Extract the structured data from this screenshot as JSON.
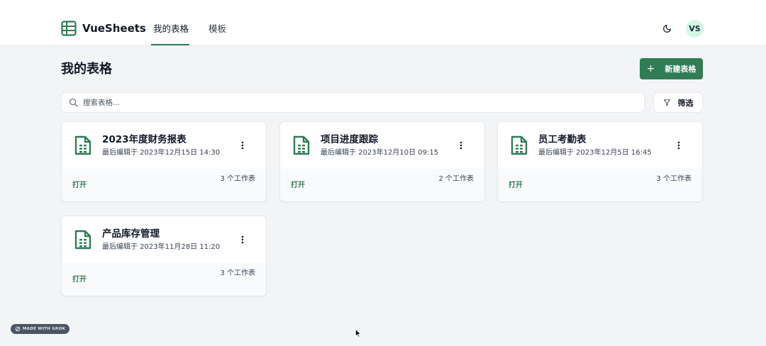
{
  "app": {
    "brand": "VueSheets",
    "accent_color": "#2e7d55"
  },
  "nav": {
    "tabs": [
      {
        "label": "我的表格",
        "active": true
      },
      {
        "label": "模板",
        "active": false
      }
    ]
  },
  "header": {
    "theme_icon": "moon-icon",
    "avatar_initials": "VS"
  },
  "page": {
    "title": "我的表格",
    "new_button_label": "新建表格"
  },
  "search": {
    "placeholder": "搜索表格...",
    "value": ""
  },
  "filter": {
    "label": "筛选"
  },
  "cards": [
    {
      "title": "2023年度财务报表",
      "edited": "最后编辑于 2023年12月15日 14:30",
      "sheets": "3 个工作表",
      "open": "打开"
    },
    {
      "title": "项目进度跟踪",
      "edited": "最后编辑于 2023年12月10日 09:15",
      "sheets": "2 个工作表",
      "open": "打开"
    },
    {
      "title": "员工考勤表",
      "edited": "最后编辑于 2023年12月5日 16:45",
      "sheets": "3 个工作表",
      "open": "打开"
    },
    {
      "title": "产品库存管理",
      "edited": "最后编辑于 2023年11月28日 11:20",
      "sheets": "3 个工作表",
      "open": "打开"
    }
  ],
  "badge": {
    "label": "MADE WITH GROK"
  }
}
